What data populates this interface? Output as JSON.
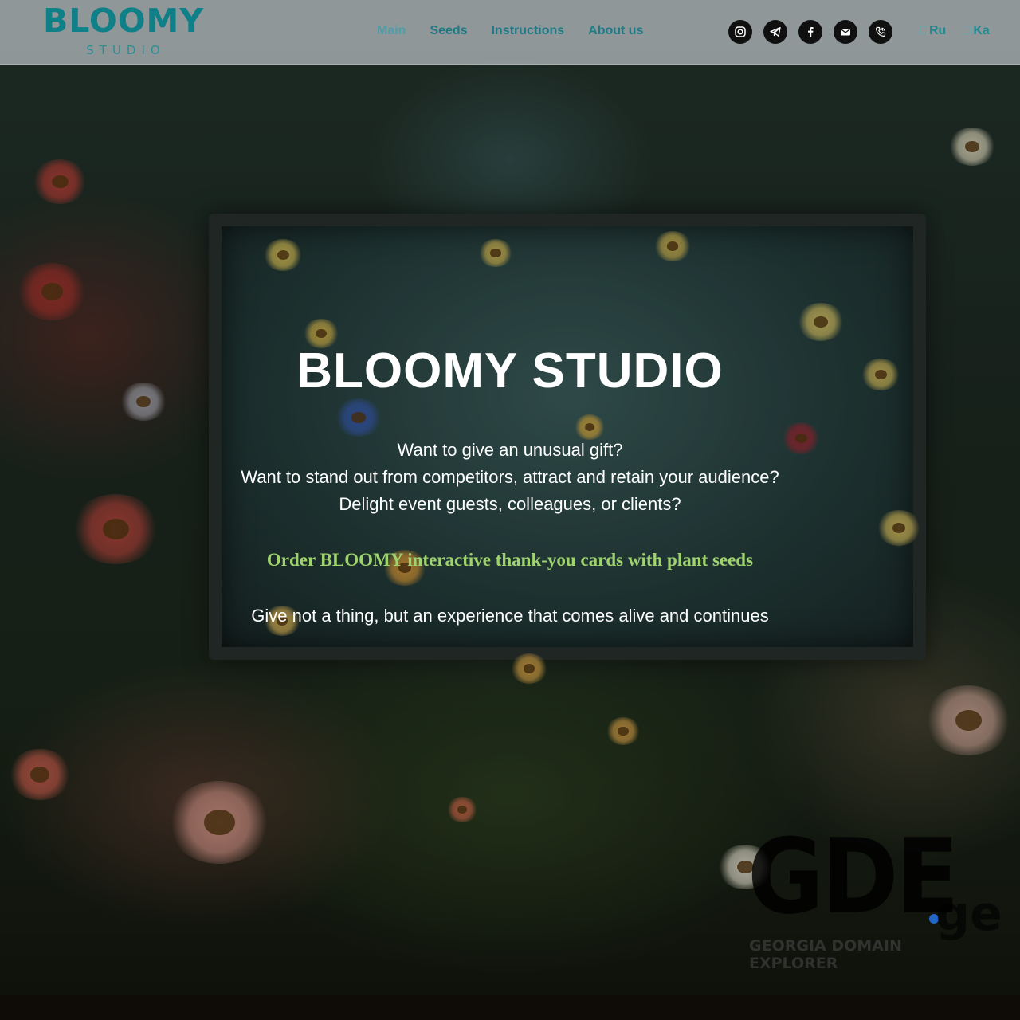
{
  "brand": {
    "logo_main": "BLOOMY",
    "logo_sub": "STUDIO",
    "color": "#0f7f88"
  },
  "nav": {
    "items": [
      {
        "label": "Main",
        "active": true
      },
      {
        "label": "Seeds",
        "active": false
      },
      {
        "label": "Instructions",
        "active": false
      },
      {
        "label": "About us",
        "active": false
      }
    ]
  },
  "socials": [
    {
      "icon": "instagram-icon"
    },
    {
      "icon": "telegram-icon"
    },
    {
      "icon": "facebook-icon"
    },
    {
      "icon": "mail-icon"
    },
    {
      "icon": "phone-icon"
    }
  ],
  "languages": [
    {
      "label": "Ru"
    },
    {
      "label": "Ka"
    }
  ],
  "hero": {
    "title": "BLOOMY STUDIO",
    "lines": [
      "Want to give an unusual gift?",
      "Want to stand out from competitors, attract and retain your audience?",
      "Delight event guests, colleagues, or clients?"
    ],
    "cta": "Order BLOOMY interactive thank-you cards with plant seeds",
    "cta_color": "#9fd36e",
    "tagline": "Give not a thing, but an experience that comes alive and continues"
  },
  "watermark": {
    "letters": "GDE",
    "tld": "ge",
    "caption": "GEORGIA DOMAIN EXPLORER",
    "dot_color": "#2166c9"
  }
}
